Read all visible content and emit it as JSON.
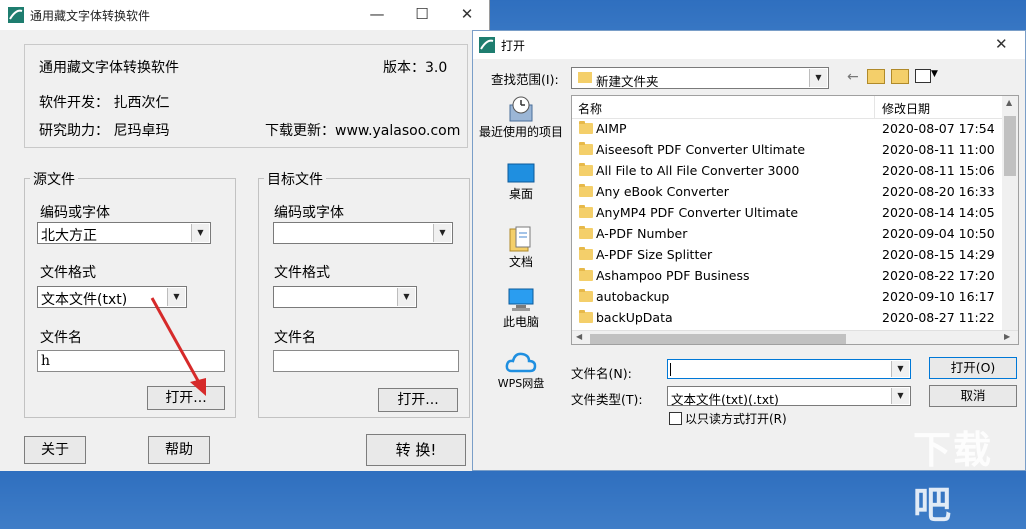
{
  "main_window": {
    "title": "通用藏文字体转换软件",
    "controls": {
      "minimize": "—",
      "maximize": "☐",
      "close": "✕"
    },
    "info": {
      "app_name": "通用藏文字体转换软件",
      "version": "版本：3.0",
      "developer": "软件开发： 扎西次仁",
      "assistant": "研究助力： 尼玛卓玛",
      "download": "下载更新：www.yalasoo.com"
    },
    "source": {
      "group_title": "源文件",
      "encoding_label": "编码或字体",
      "encoding_value": "北大方正",
      "format_label": "文件格式",
      "format_value": "文本文件(txt)",
      "filename_label": "文件名",
      "filename_value": "h",
      "open_button": "打开..."
    },
    "target": {
      "group_title": "目标文件",
      "encoding_label": "编码或字体",
      "encoding_value": "",
      "format_label": "文件格式",
      "format_value": "",
      "filename_label": "文件名",
      "filename_value": "",
      "open_button": "打开..."
    },
    "buttons": {
      "about": "关于",
      "help": "帮助",
      "convert": "转 换!"
    }
  },
  "open_dialog": {
    "title": "打开",
    "close": "✕",
    "look_in_label": "查找范围(I):",
    "look_in_value": "新建文件夹",
    "sidebar": [
      {
        "label": "最近使用的项目",
        "icon": "recent-clock-icon"
      },
      {
        "label": "桌面",
        "icon": "desktop-icon"
      },
      {
        "label": "文档",
        "icon": "documents-icon"
      },
      {
        "label": "此电脑",
        "icon": "computer-icon"
      },
      {
        "label": "WPS网盘",
        "icon": "cloud-icon"
      }
    ],
    "columns": {
      "name": "名称",
      "modified": "修改日期"
    },
    "files": [
      {
        "name": "AIMP",
        "date": "2020-08-07 17:54"
      },
      {
        "name": "Aiseesoft PDF Converter Ultimate",
        "date": "2020-08-11 11:00"
      },
      {
        "name": "All File to All File Converter 3000",
        "date": "2020-08-11 15:06"
      },
      {
        "name": "Any eBook Converter",
        "date": "2020-08-20 16:33"
      },
      {
        "name": "AnyMP4 PDF Converter Ultimate",
        "date": "2020-08-14 14:05"
      },
      {
        "name": "A-PDF Number",
        "date": "2020-09-04 10:50"
      },
      {
        "name": "A-PDF Size Splitter",
        "date": "2020-08-15 14:29"
      },
      {
        "name": "Ashampoo PDF Business",
        "date": "2020-08-22 17:20"
      },
      {
        "name": "autobackup",
        "date": "2020-09-10 16:17"
      },
      {
        "name": "backUpData",
        "date": "2020-08-27 11:22"
      }
    ],
    "filename_label": "文件名(N):",
    "filename_value": "",
    "filetype_label": "文件类型(T):",
    "filetype_value": "文本文件(txt)(.txt)",
    "readonly_label": "以只读方式打开(R)",
    "open_button": "打开(O)",
    "cancel_button": "取消"
  },
  "watermark": "下载吧",
  "colors": {
    "folder": "#f4cf6a",
    "selection_border": "#0078d7",
    "arrow": "#d62a2a"
  }
}
